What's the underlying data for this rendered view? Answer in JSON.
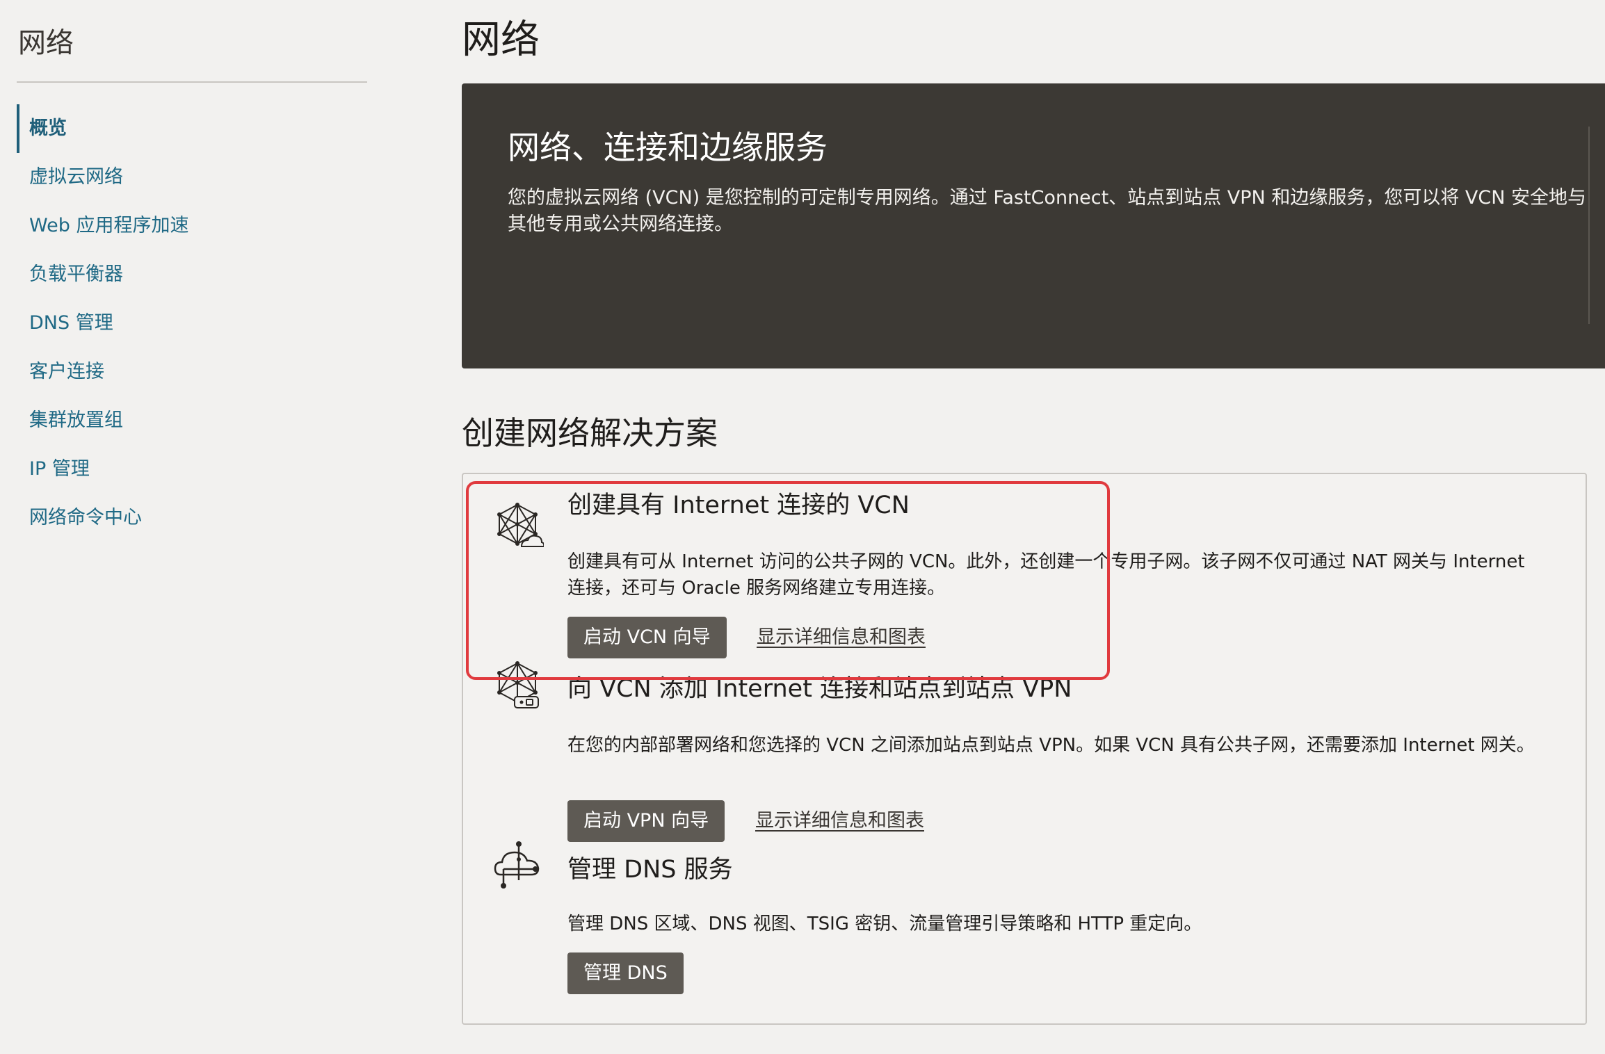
{
  "sidebar": {
    "title": "网络",
    "items": [
      {
        "label": "概览",
        "active": true
      },
      {
        "label": "虚拟云网络",
        "active": false
      },
      {
        "label": "Web 应用程序加速",
        "active": false
      },
      {
        "label": "负载平衡器",
        "active": false
      },
      {
        "label": "DNS 管理",
        "active": false
      },
      {
        "label": "客户连接",
        "active": false
      },
      {
        "label": "集群放置组",
        "active": false
      },
      {
        "label": "IP 管理",
        "active": false
      },
      {
        "label": "网络命令中心",
        "active": false
      }
    ]
  },
  "main": {
    "title": "网络",
    "hero": {
      "title": "网络、连接和边缘服务",
      "description": "您的虚拟云网络 (VCN) 是您控制的可定制专用网络。通过 FastConnect、站点到站点 VPN 和边缘服务，您可以将 VCN 安全地与其他专用或公共网络连接。"
    },
    "section_title": "创建网络解决方案",
    "solutions": [
      {
        "icon": "network-cloud-icon",
        "title": "创建具有 Internet 连接的 VCN",
        "description": "创建具有可从 Internet 访问的公共子网的 VCN。此外，还创建一个专用子网。该子网不仅可通过 NAT 网关与 Internet 连接，还可与 Oracle 服务网络建立专用连接。",
        "button": "启动 VCN 向导",
        "link": "显示详细信息和图表"
      },
      {
        "icon": "network-vpn-icon",
        "title": "向 VCN 添加 Internet 连接和站点到站点 VPN",
        "description": "在您的内部部署网络和您选择的 VCN 之间添加站点到站点 VPN。如果 VCN 具有公共子网，还需要添加 Internet 网关。",
        "button": "启动 VPN 向导",
        "link": "显示详细信息和图表"
      },
      {
        "icon": "dns-cloud-icon",
        "title": "管理 DNS 服务",
        "description": "管理 DNS 区域、DNS 视图、TSIG 密钥、流量管理引导策略和 HTTP 重定向。",
        "button": "管理 DNS"
      }
    ]
  },
  "colors": {
    "nav_link": "#1f6985",
    "hero_background": "#3c3934",
    "button_background": "#5e5a54",
    "highlight_border": "#e03a3e"
  }
}
